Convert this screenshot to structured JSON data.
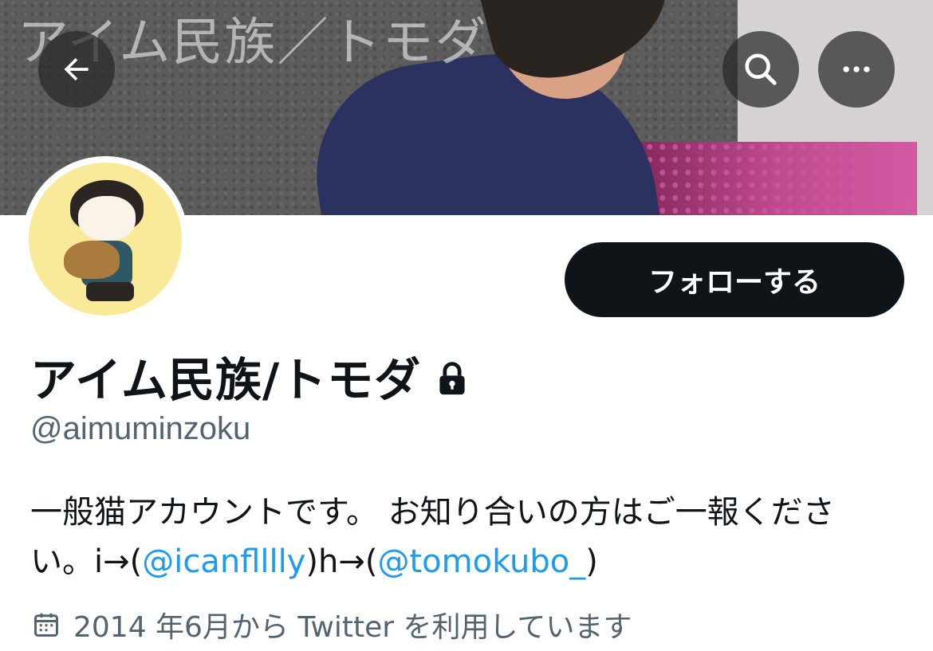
{
  "banner": {
    "title": "アイム民族／トモダ"
  },
  "nav": {
    "back_icon": "arrow-left-icon",
    "search_icon": "search-icon",
    "more_icon": "more-horizontal-icon"
  },
  "profile": {
    "display_name": "アイム民族/トモダ",
    "handle": "@aimuminzoku",
    "protected_icon": "lock-icon",
    "follow_label": "フォローする",
    "bio": {
      "line1": "一般猫アカウントです。 お知り合いの方はご一報くださ",
      "line2_prefix": "い。i→(",
      "mention1": "@icanflllly",
      "line2_middle": ")h→(",
      "mention2": "@tomokubo_",
      "line2_suffix": ")"
    },
    "joined_icon": "calendar-icon",
    "joined_text": "2014 年6月から Twitter を利用しています"
  },
  "colors": {
    "text": "#0f1419",
    "secondary": "#536471",
    "link": "#1d9bf0",
    "follow_bg": "#0f1419"
  }
}
